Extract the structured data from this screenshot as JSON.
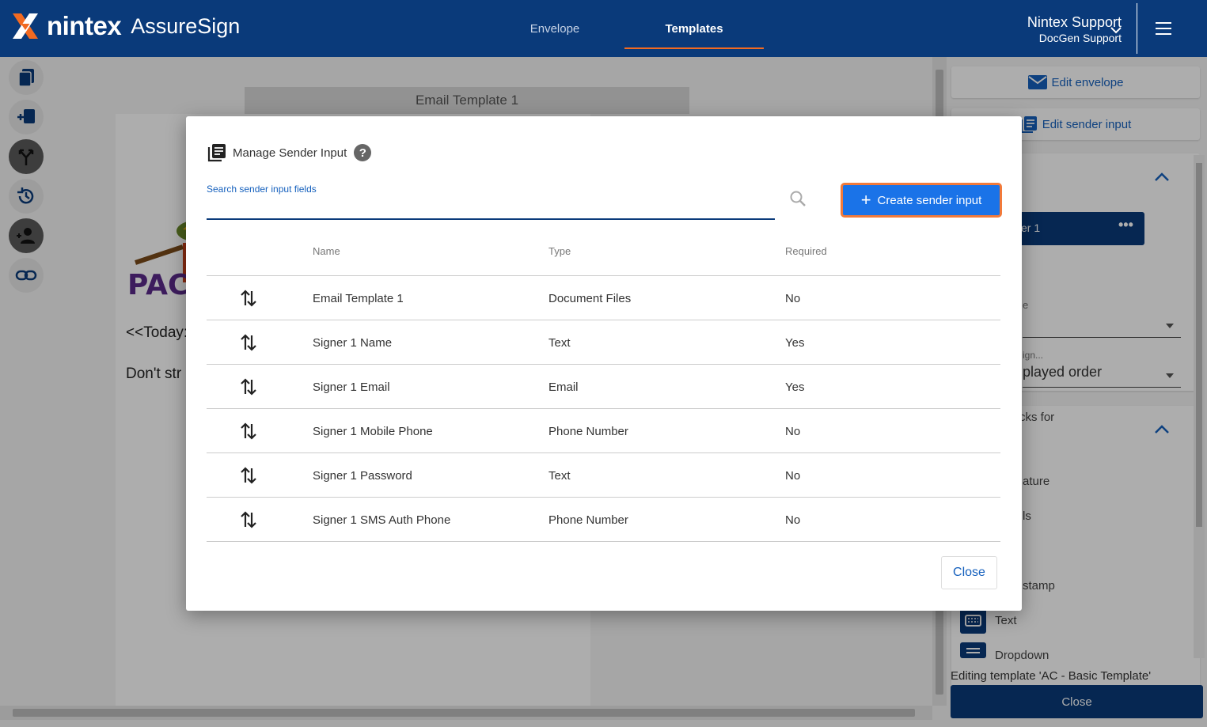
{
  "header": {
    "logo_word": "nintex",
    "logo_product": "AssureSign",
    "tabs": [
      {
        "label": "Envelope",
        "active": false
      },
      {
        "label": "Templates",
        "active": true
      }
    ],
    "user_name": "Nintex Support",
    "user_org": "DocGen Support"
  },
  "document": {
    "title": "Email Template 1",
    "line1": "<<Today:",
    "line2": "Don't str"
  },
  "right_panel": {
    "edit_envelope": "Edit envelope",
    "edit_sender_input": "Edit sender input",
    "signer_label": "er 1",
    "field1_label": "e",
    "field2_label": "ign...",
    "field2_value": "played order",
    "section2_label": "cks for",
    "items": [
      "ature",
      "ls",
      "stamp",
      "Text",
      "Dropdown"
    ],
    "footer_text": "Editing template 'AC - Basic Template'",
    "close_label": "Close"
  },
  "modal": {
    "title": "Manage Sender Input",
    "help_glyph": "?",
    "search_label": "Search sender input fields",
    "search_value": "",
    "create_label": "Create sender input",
    "columns": {
      "name": "Name",
      "type": "Type",
      "required": "Required"
    },
    "rows": [
      {
        "name": "Email Template 1",
        "type": "Document Files",
        "required": "No"
      },
      {
        "name": "Signer 1 Name",
        "type": "Text",
        "required": "Yes"
      },
      {
        "name": "Signer 1 Email",
        "type": "Email",
        "required": "Yes"
      },
      {
        "name": "Signer 1 Mobile Phone",
        "type": "Phone Number",
        "required": "No"
      },
      {
        "name": "Signer 1 Password",
        "type": "Text",
        "required": "No"
      },
      {
        "name": "Signer 1 SMS Auth Phone",
        "type": "Phone Number",
        "required": "No"
      }
    ],
    "close_label": "Close"
  },
  "colors": {
    "header_bg": "#0a3a7a",
    "accent_orange": "#f26a21",
    "primary_blue": "#1a73e8",
    "link_blue": "#1560bd"
  }
}
